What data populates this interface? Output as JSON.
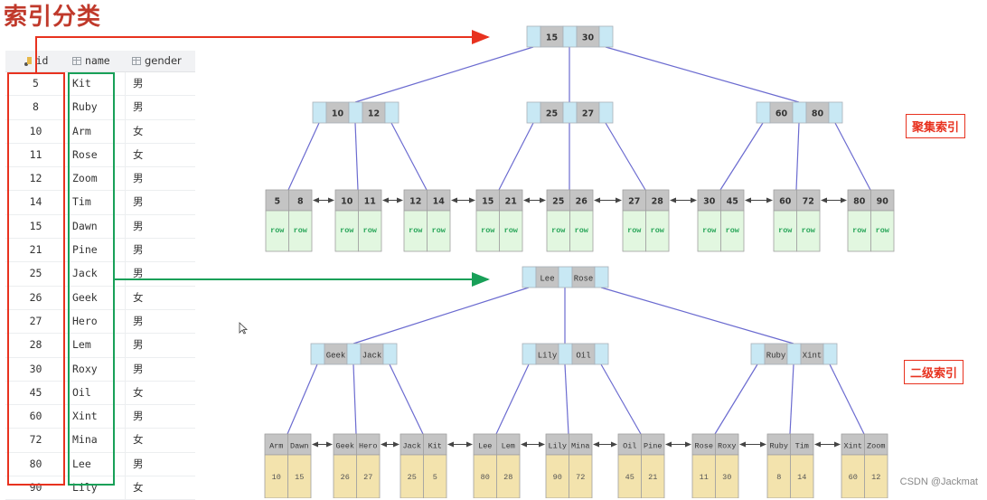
{
  "title": "索引分类",
  "table": {
    "columns": [
      {
        "label": "id",
        "icon": "primary-key-icon"
      },
      {
        "label": "name",
        "icon": "column-icon"
      },
      {
        "label": "gender",
        "icon": "column-icon"
      }
    ],
    "rows": [
      [
        "5",
        "Kit",
        "男"
      ],
      [
        "8",
        "Ruby",
        "男"
      ],
      [
        "10",
        "Arm",
        "女"
      ],
      [
        "11",
        "Rose",
        "女"
      ],
      [
        "12",
        "Zoom",
        "男"
      ],
      [
        "14",
        "Tim",
        "男"
      ],
      [
        "15",
        "Dawn",
        "男"
      ],
      [
        "21",
        "Pine",
        "男"
      ],
      [
        "25",
        "Jack",
        "男"
      ],
      [
        "26",
        "Geek",
        "女"
      ],
      [
        "27",
        "Hero",
        "男"
      ],
      [
        "28",
        "Lem",
        "男"
      ],
      [
        "30",
        "Roxy",
        "男"
      ],
      [
        "45",
        "Oil",
        "女"
      ],
      [
        "60",
        "Xint",
        "男"
      ],
      [
        "72",
        "Mina",
        "女"
      ],
      [
        "80",
        "Lee",
        "男"
      ],
      [
        "90",
        "Lily",
        "女"
      ]
    ]
  },
  "clustered": {
    "label": "聚集索引",
    "root": [
      "15",
      "30"
    ],
    "internal": [
      [
        "10",
        "12"
      ],
      [
        "25",
        "27"
      ],
      [
        "60",
        "80"
      ]
    ],
    "leaves": [
      {
        "keys": [
          "5",
          "8"
        ],
        "vals": [
          "row",
          "row"
        ]
      },
      {
        "keys": [
          "10",
          "11"
        ],
        "vals": [
          "row",
          "row"
        ]
      },
      {
        "keys": [
          "12",
          "14"
        ],
        "vals": [
          "row",
          "row"
        ]
      },
      {
        "keys": [
          "15",
          "21"
        ],
        "vals": [
          "row",
          "row"
        ]
      },
      {
        "keys": [
          "25",
          "26"
        ],
        "vals": [
          "row",
          "row"
        ]
      },
      {
        "keys": [
          "27",
          "28"
        ],
        "vals": [
          "row",
          "row"
        ]
      },
      {
        "keys": [
          "30",
          "45"
        ],
        "vals": [
          "row",
          "row"
        ]
      },
      {
        "keys": [
          "60",
          "72"
        ],
        "vals": [
          "row",
          "row"
        ]
      },
      {
        "keys": [
          "80",
          "90"
        ],
        "vals": [
          "row",
          "row"
        ]
      }
    ]
  },
  "secondary": {
    "label": "二级索引",
    "root": [
      "Lee",
      "Rose"
    ],
    "internal": [
      [
        "Geek",
        "Jack"
      ],
      [
        "Lily",
        "Oil"
      ],
      [
        "Ruby",
        "Xint"
      ]
    ],
    "leaves": [
      {
        "keys": [
          "Arm",
          "Dawn"
        ],
        "vals": [
          "10",
          "15"
        ]
      },
      {
        "keys": [
          "Geek",
          "Hero"
        ],
        "vals": [
          "26",
          "27"
        ]
      },
      {
        "keys": [
          "Jack",
          "Kit"
        ],
        "vals": [
          "25",
          "5"
        ]
      },
      {
        "keys": [
          "Lee",
          "Lem"
        ],
        "vals": [
          "80",
          "28"
        ]
      },
      {
        "keys": [
          "Lily",
          "Mina"
        ],
        "vals": [
          "90",
          "72"
        ]
      },
      {
        "keys": [
          "Oil",
          "Pine"
        ],
        "vals": [
          "45",
          "21"
        ]
      },
      {
        "keys": [
          "Rose",
          "Roxy"
        ],
        "vals": [
          "11",
          "30"
        ]
      },
      {
        "keys": [
          "Ruby",
          "Tim"
        ],
        "vals": [
          "8",
          "14"
        ]
      },
      {
        "keys": [
          "Xint",
          "Zoom"
        ],
        "vals": [
          "60",
          "12"
        ]
      }
    ]
  },
  "colors": {
    "red": "#e8321f",
    "green": "#18a058",
    "pointer_cell": "#c8e8f4",
    "key_cell": "#c4c4c4",
    "row_cell": "#e2f7e0",
    "row_text": "#2aa65a",
    "sec_value_cell": "#f3e3ad",
    "edge": "#6b6bd0"
  },
  "watermark": "CSDN @Jackmat"
}
